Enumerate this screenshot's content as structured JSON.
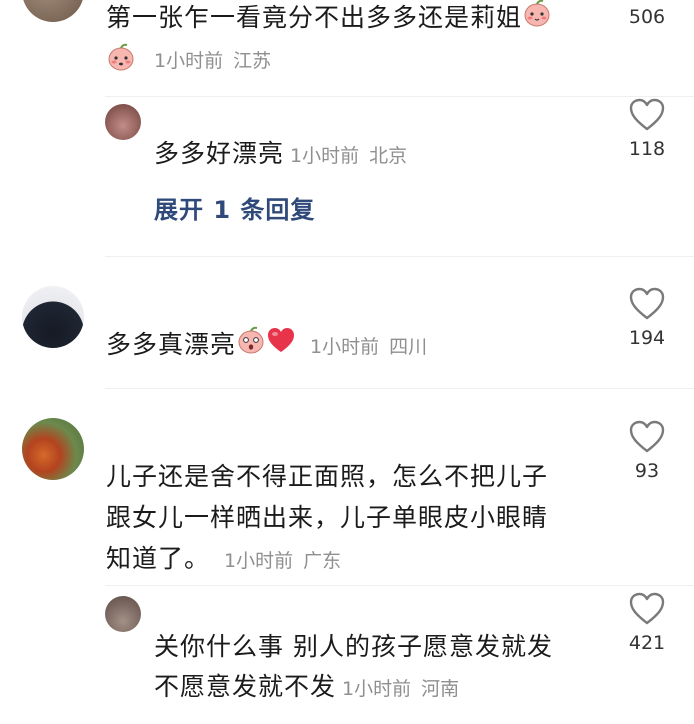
{
  "comments": [
    {
      "text": "第一张乍一看竟分不出多多还是莉姐",
      "time": "1小时前",
      "location": "江苏",
      "likes": "506",
      "emojis": [
        "peach-face-icon",
        "peach-face-icon"
      ]
    },
    {
      "type": "reply",
      "text": "多多好漂亮",
      "time": "1小时前",
      "location": "北京",
      "likes": "118"
    },
    {
      "text": "多多真漂亮",
      "time": "1小时前",
      "location": "四川",
      "likes": "194",
      "emojis": [
        "peach-face-icon",
        "red-heart-icon"
      ]
    },
    {
      "text_lines": [
        "儿子还是舍不得正面照，怎么不把儿子",
        "跟女儿一样晒出来，儿子单眼皮小眼睛",
        "知道了。"
      ],
      "time": "1小时前",
      "location": "广东",
      "likes": "93"
    },
    {
      "type": "reply",
      "text_lines": [
        "关你什么事 别人的孩子愿意发就发",
        "不愿意发就不发"
      ],
      "time": "1小时前",
      "location": "河南",
      "likes": "421"
    }
  ],
  "expand_replies": "展开 1 条回复",
  "colors": {
    "text": "#1b1b1b",
    "meta": "#8f8f8f",
    "link": "#2f4a7a",
    "heart_outline": "#7a7a7a",
    "heart_red": "#e8344b"
  }
}
